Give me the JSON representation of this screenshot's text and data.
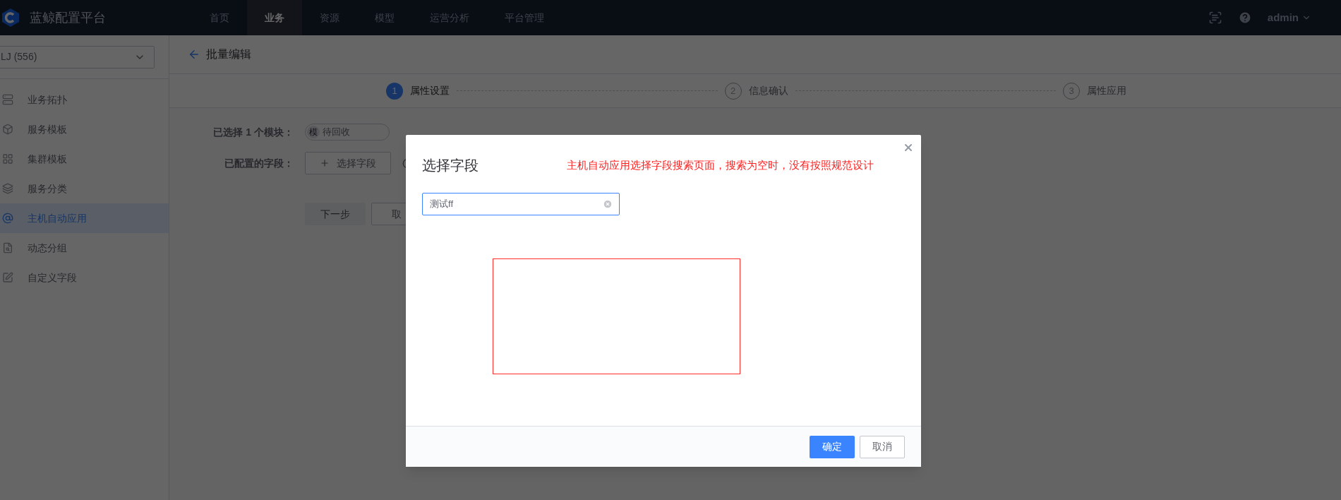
{
  "nav": {
    "brand": "蓝鲸配置平台",
    "items": [
      {
        "label": "首页",
        "selected": false
      },
      {
        "label": "业务",
        "selected": true
      },
      {
        "label": "资源",
        "selected": false
      },
      {
        "label": "模型",
        "selected": false
      },
      {
        "label": "运营分析",
        "selected": false
      },
      {
        "label": "平台管理",
        "selected": false
      }
    ],
    "user": "admin"
  },
  "sidebar": {
    "business_select": "LJ (556)",
    "items": [
      {
        "label": "业务拓扑",
        "selected": false
      },
      {
        "label": "服务模板",
        "selected": false
      },
      {
        "label": "集群模板",
        "selected": false
      },
      {
        "label": "服务分类",
        "selected": false
      },
      {
        "label": "主机自动应用",
        "selected": true
      },
      {
        "label": "动态分组",
        "selected": false
      },
      {
        "label": "自定义字段",
        "selected": false
      }
    ]
  },
  "page": {
    "title": "批量编辑",
    "steps": [
      {
        "number": "1",
        "label": "属性设置",
        "selected": true
      },
      {
        "number": "2",
        "label": "信息确认",
        "selected": false
      },
      {
        "number": "3",
        "label": "属性应用",
        "selected": false
      }
    ],
    "form": {
      "selected_label": "已选择 1 个模块：",
      "module_tag": {
        "badge": "模",
        "label": "待回收"
      },
      "fields_label": "已配置的字段：",
      "select_field_button": "选择字段",
      "next_button": {
        "label": "下一步",
        "disabled": true
      },
      "cancel_button": "取"
    }
  },
  "modal": {
    "title": "选择字段",
    "annotation": "主机自动应用选择字段搜索页面，搜索为空时，没有按照规范设计",
    "search": {
      "value": "测试ff"
    },
    "buttons": [
      {
        "label": "确定",
        "kind": "primary"
      },
      {
        "label": "取消",
        "kind": "default"
      }
    ]
  }
}
